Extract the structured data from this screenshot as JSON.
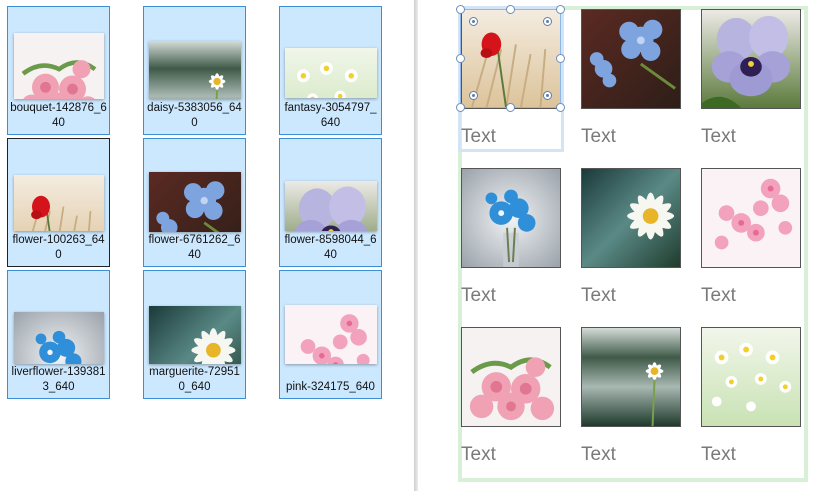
{
  "explorer": {
    "files": [
      {
        "name": "bouquet-142876_640",
        "icon": "pink-roses-photo-thumbnail"
      },
      {
        "name": "daisy-5383056_640",
        "icon": "daisy-photo-thumbnail"
      },
      {
        "name": "fantasy-3054797_640",
        "icon": "meadow-flowers-photo-thumbnail"
      },
      {
        "name": "flower-100263_640",
        "icon": "red-poppy-photo-thumbnail"
      },
      {
        "name": "flower-6761262_640",
        "icon": "blue-flower-photo-thumbnail"
      },
      {
        "name": "flower-8598044_640",
        "icon": "pansy-photo-thumbnail"
      },
      {
        "name": "liverflower-1393813_640",
        "icon": "liverflower-photo-thumbnail"
      },
      {
        "name": "marguerite-729510_640",
        "icon": "marguerite-photo-thumbnail"
      },
      {
        "name": "pink-324175_640",
        "icon": "cherry-blossom-photo-thumbnail"
      }
    ]
  },
  "canvas": {
    "cells": [
      {
        "caption": "Text",
        "image": "red-poppy-image"
      },
      {
        "caption": "Text",
        "image": "blue-flower-image"
      },
      {
        "caption": "Text",
        "image": "pansy-image"
      },
      {
        "caption": "Text",
        "image": "liverflower-image"
      },
      {
        "caption": "Text",
        "image": "marguerite-image"
      },
      {
        "caption": "Text",
        "image": "cherry-blossom-image"
      },
      {
        "caption": "Text",
        "image": "pink-roses-image"
      },
      {
        "caption": "Text",
        "image": "daisy-image"
      },
      {
        "caption": "Text",
        "image": "meadow-flowers-image"
      }
    ]
  },
  "colors": {
    "selection_fill": "#cce8ff",
    "selection_border": "#3c8fd6",
    "group_border": "#d8f0d8",
    "caption_text": "#7a7a7a"
  }
}
